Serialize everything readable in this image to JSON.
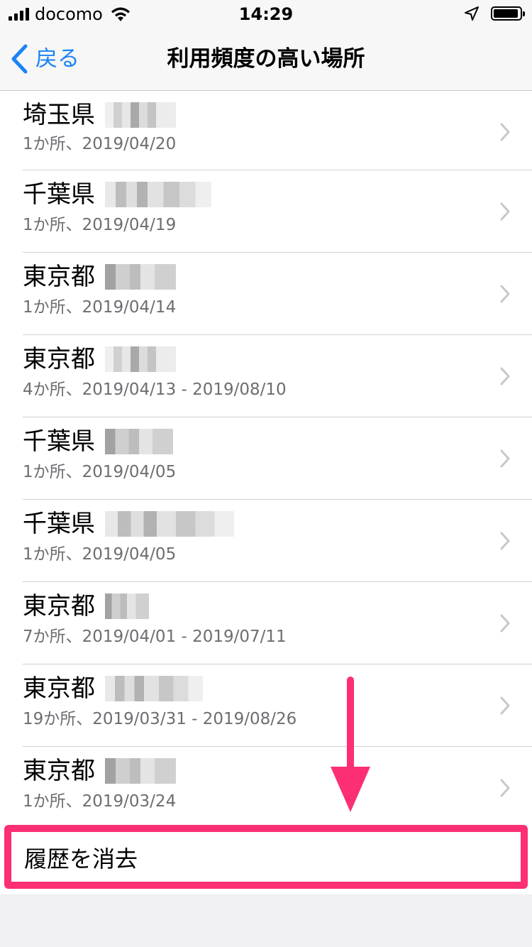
{
  "status_bar": {
    "carrier": "docomo",
    "time": "14:29"
  },
  "nav": {
    "back_label": "戻る",
    "title": "利用頻度の高い場所"
  },
  "locations": [
    {
      "prefecture": "埼玉県",
      "detail": "1か所、2019/04/20"
    },
    {
      "prefecture": "千葉県",
      "detail": "1か所、2019/04/19"
    },
    {
      "prefecture": "東京都",
      "detail": "1か所、2019/04/14"
    },
    {
      "prefecture": "東京都",
      "detail": "4か所、2019/04/13 - 2019/08/10"
    },
    {
      "prefecture": "千葉県",
      "detail": "1か所、2019/04/05"
    },
    {
      "prefecture": "千葉県",
      "detail": "1か所、2019/04/05"
    },
    {
      "prefecture": "東京都",
      "detail": "7か所、2019/04/01 - 2019/07/11"
    },
    {
      "prefecture": "東京都",
      "detail": "19か所、2019/03/31 - 2019/08/26"
    },
    {
      "prefecture": "東京都",
      "detail": "1か所、2019/03/24"
    }
  ],
  "clear_history": {
    "label": "履歴を消去"
  },
  "colors": {
    "accent": "#1a83f6",
    "highlight": "#fc2f74"
  },
  "icons": {
    "back": "chevron-left-icon",
    "row": "chevron-right-icon",
    "annotation": "down-arrow-icon"
  }
}
